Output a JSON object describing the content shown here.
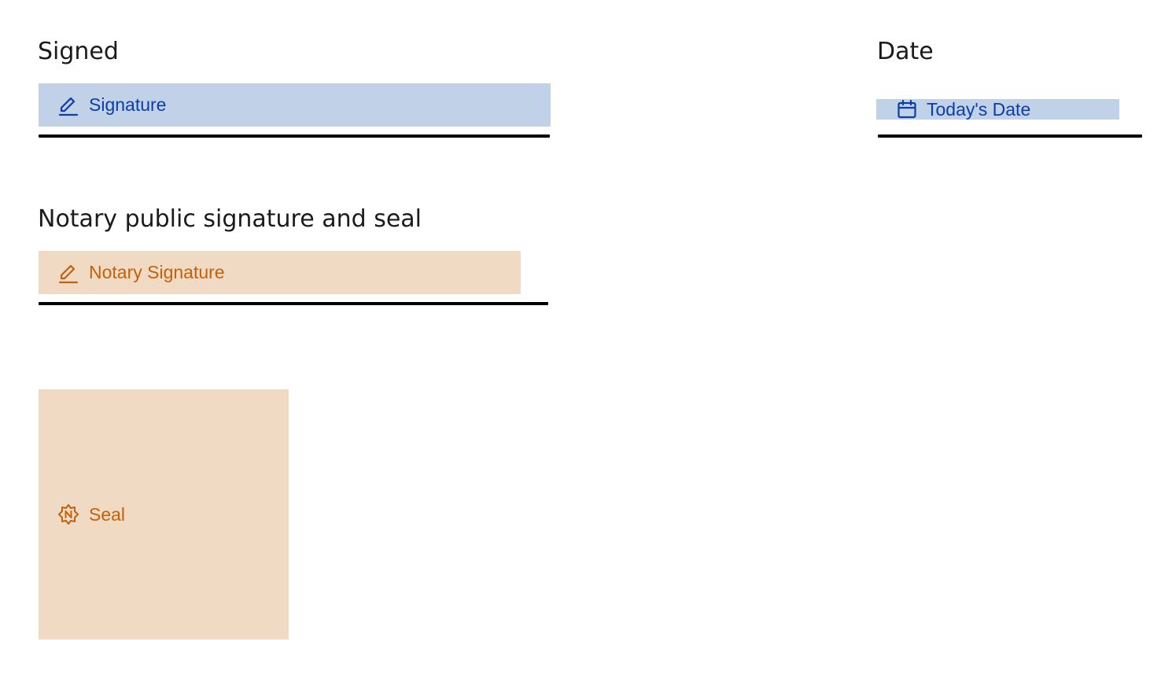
{
  "signed_section": {
    "label": "Signed",
    "signature_field": {
      "text": "Signature",
      "icon": "pen-icon"
    }
  },
  "date_section": {
    "label": "Date",
    "date_field": {
      "text": "Today's Date",
      "icon": "calendar-icon"
    }
  },
  "notary_section": {
    "label": "Notary public signature and seal",
    "notary_signature_field": {
      "text": "Notary Signature",
      "icon": "pen-icon"
    },
    "seal_field": {
      "text": "Seal",
      "icon": "notary-seal-icon"
    }
  },
  "colors": {
    "signer_fill": "#c0d1e8",
    "signer_text": "#0b3ea8",
    "notary_fill": "#f1dac4",
    "notary_text": "#c2610a"
  }
}
